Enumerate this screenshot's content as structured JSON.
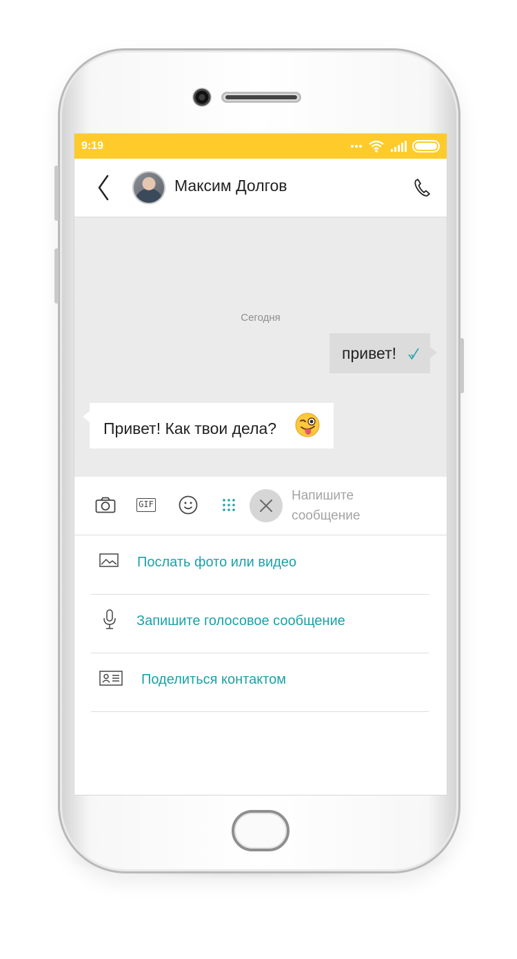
{
  "status_bar": {
    "time": "9:19",
    "icons": [
      "more-dots-icon",
      "wifi-icon",
      "signal-icon",
      "battery-icon"
    ],
    "color": "#fecb2b"
  },
  "header": {
    "contact_name": "Максим Долгов",
    "icons": [
      "back-icon",
      "avatar",
      "phone-icon"
    ]
  },
  "chat": {
    "date_separator": "Сегодня",
    "messages": [
      {
        "direction": "outgoing",
        "text": "привет!",
        "status": "read-check"
      },
      {
        "direction": "incoming",
        "text": "Привет! Как твои дела?",
        "emoji": "winking-tongue-emoji"
      }
    ]
  },
  "composer": {
    "tools": [
      "camera-icon",
      "gif-icon",
      "smiley-icon",
      "apps-grid-icon"
    ],
    "gif_label": "GIF",
    "close_icon": "close-icon",
    "placeholder_line1": "Напишите",
    "placeholder_line2": "сообщение"
  },
  "attach_menu": {
    "items": [
      {
        "icon": "image-icon",
        "label": "Послать фото или видео"
      },
      {
        "icon": "microphone-icon",
        "label": "Запишите голосовое сообщение"
      },
      {
        "icon": "contact-card-icon",
        "label": "Поделиться контактом"
      }
    ],
    "accent_color": "#1aa1a6"
  }
}
